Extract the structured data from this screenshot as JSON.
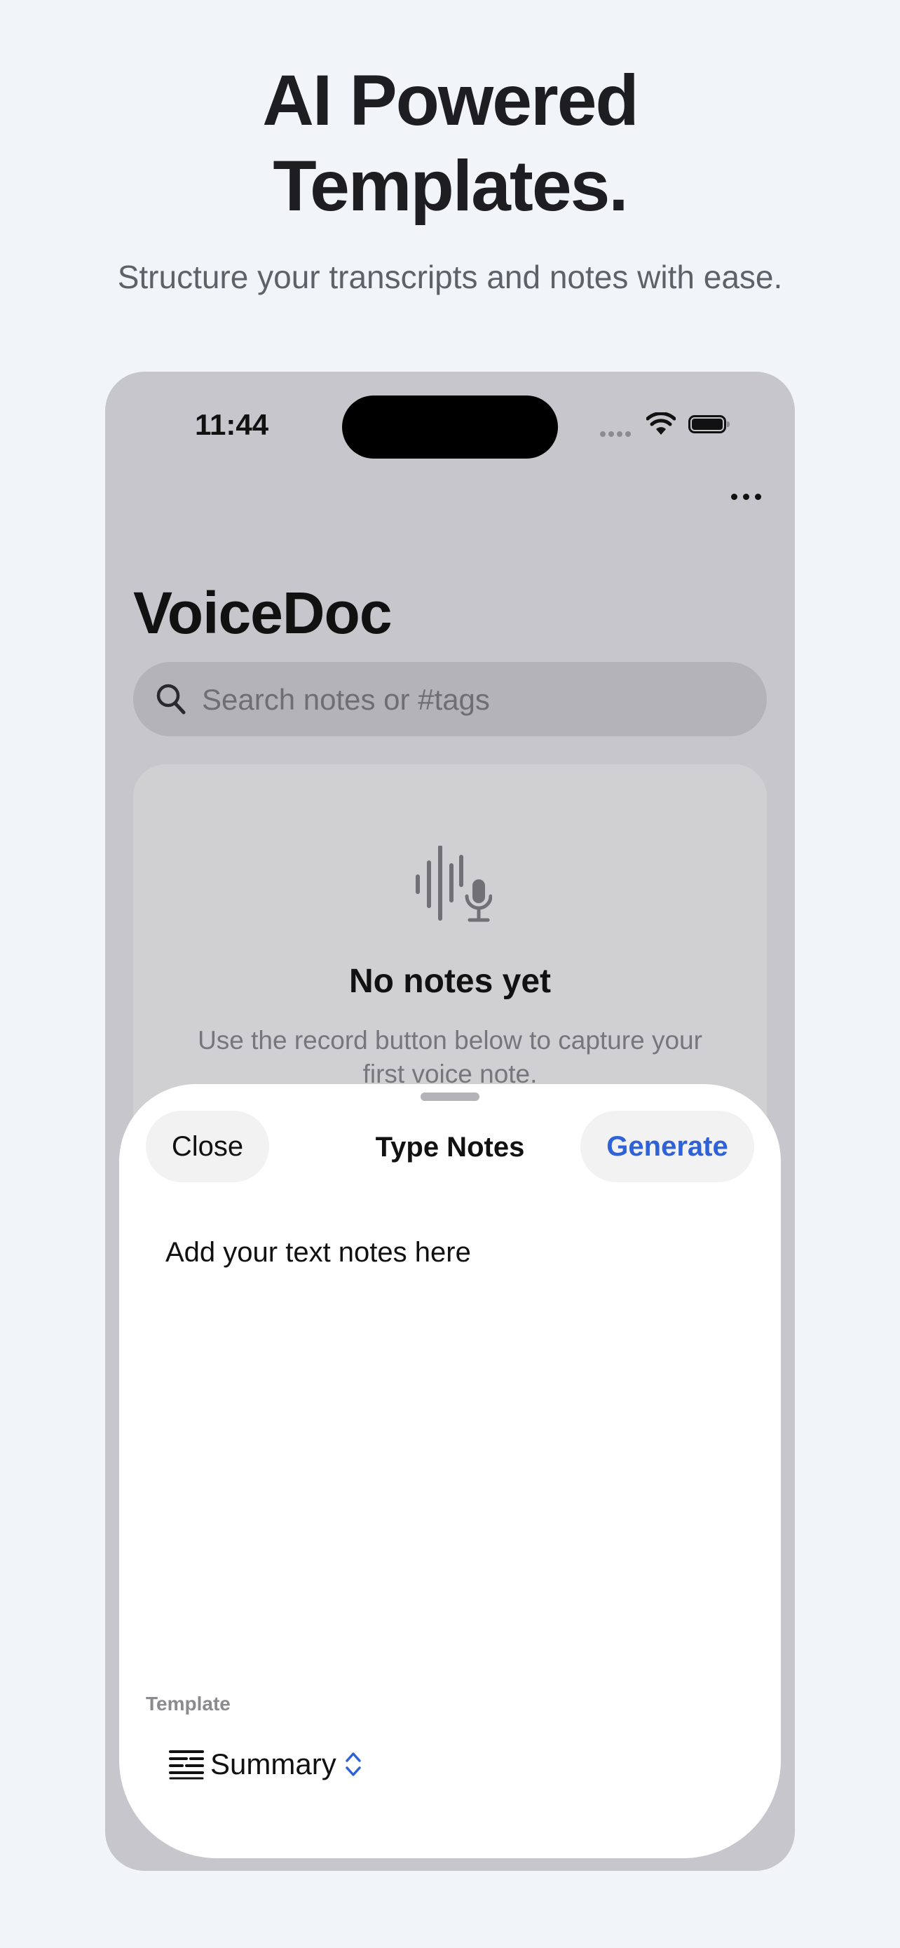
{
  "header": {
    "line1": "AI Powered",
    "line2": "Templates.",
    "subtitle": "Structure your transcripts and notes with ease."
  },
  "status_bar": {
    "time": "11:44",
    "icons": [
      "cellular-signal-icon",
      "wifi-icon",
      "battery-icon"
    ]
  },
  "app": {
    "title": "VoiceDoc",
    "more_icon": "ellipsis-icon",
    "search": {
      "placeholder": "Search notes or #tags",
      "icon": "search-icon"
    },
    "empty_state": {
      "icon": "waveform-microphone-icon",
      "title": "No notes yet",
      "description": "Use the record button below to capture your first voice note."
    }
  },
  "sheet": {
    "close_label": "Close",
    "title": "Type Notes",
    "generate_label": "Generate",
    "notes_placeholder": "Add your text notes here",
    "template_label": "Template",
    "template_value": "Summary",
    "template_icon": "text-lines-icon",
    "chevron_icon": "chevron-up-down-icon"
  },
  "colors": {
    "page_background": "#f1f4f9",
    "accent": "#2f62d8",
    "dimmed_screen": "#c6c6cc",
    "sheet_background": "#ffffff"
  }
}
